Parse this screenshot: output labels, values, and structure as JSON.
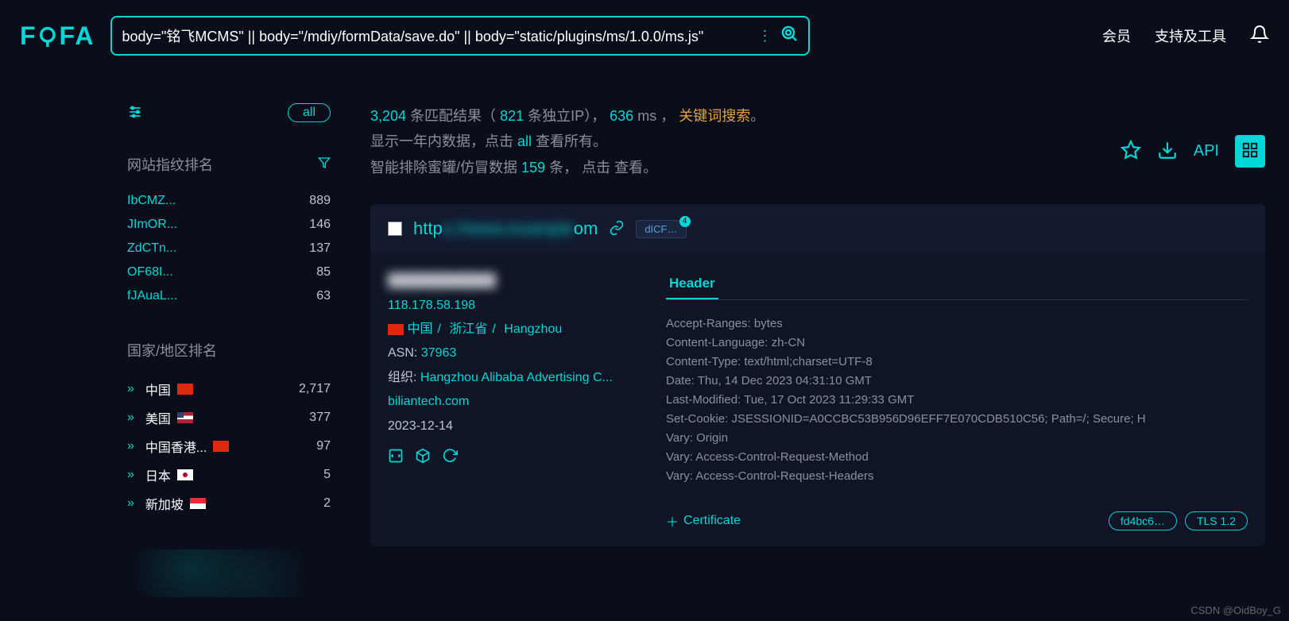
{
  "header": {
    "logo": "FOFA",
    "search_value": "body=\"铭飞MCMS\" || body=\"/mdiy/formData/save.do\" || body=\"static/plugins/ms/1.0.0/ms.js\"",
    "nav": {
      "member": "会员",
      "support": "支持及工具"
    }
  },
  "results_meta": {
    "total": "3,204",
    "text1": "条匹配结果（",
    "ips": "821",
    "text2": "条独立IP）， ",
    "ms": "636",
    "text3": "ms ， ",
    "keyword": "关键词搜索",
    "line2a": "显示一年内数据，点击 ",
    "line2_all": "all",
    "line2b": " 查看所有。",
    "line3a": "智能排除蜜罐/仿冒数据 ",
    "line3_num": "159",
    "line3b": " 条，  点击 查看。"
  },
  "api_label": "API",
  "sidebar": {
    "all_label": "all",
    "fingerprint": {
      "title": "网站指纹排名",
      "items": [
        {
          "label": "IbCMZ...",
          "count": "889"
        },
        {
          "label": "JImOR...",
          "count": "146"
        },
        {
          "label": "ZdCTn...",
          "count": "137"
        },
        {
          "label": "OF68I...",
          "count": "85"
        },
        {
          "label": "fJAuaL...",
          "count": "63"
        }
      ]
    },
    "country": {
      "title": "国家/地区排名",
      "items": [
        {
          "label": "中国",
          "flag": "cn",
          "count": "2,717"
        },
        {
          "label": "美国",
          "flag": "us",
          "count": "377"
        },
        {
          "label": "中国香港...",
          "flag": "hk",
          "count": "97"
        },
        {
          "label": "日本",
          "flag": "jp",
          "count": "5"
        },
        {
          "label": "新加坡",
          "flag": "sg",
          "count": "2"
        }
      ]
    }
  },
  "result": {
    "url_prefix": "http",
    "url_blur": "s://www.example",
    "url_suffix": "om",
    "tag": "dICF…",
    "tag_count": "4",
    "ip": "118.178.58.198",
    "country": "中国",
    "province": "浙江省",
    "city": "Hangzhou",
    "asn_label": "ASN:",
    "asn": "37963",
    "org_label": "组织:",
    "org": "Hangzhou Alibaba Advertising C...",
    "domain": "biliantech.com",
    "date": "2023-12-14",
    "tab_header": "Header",
    "headers": [
      "Accept-Ranges: bytes",
      "Content-Language: zh-CN",
      "Content-Type: text/html;charset=UTF-8",
      "Date: Thu, 14 Dec 2023 04:31:10 GMT",
      "Last-Modified: Tue, 17 Oct 2023 11:29:33 GMT",
      "Set-Cookie: JSESSIONID=A0CCBC53B956D96EFF7E070CDB510C56; Path=/; Secure; H",
      "Vary: Origin",
      "Vary: Access-Control-Request-Method",
      "Vary: Access-Control-Request-Headers"
    ],
    "certificate": "Certificate",
    "hash_pill": "fd4bc6…",
    "tls_pill": "TLS 1.2"
  },
  "watermark": "CSDN @OidBoy_G"
}
